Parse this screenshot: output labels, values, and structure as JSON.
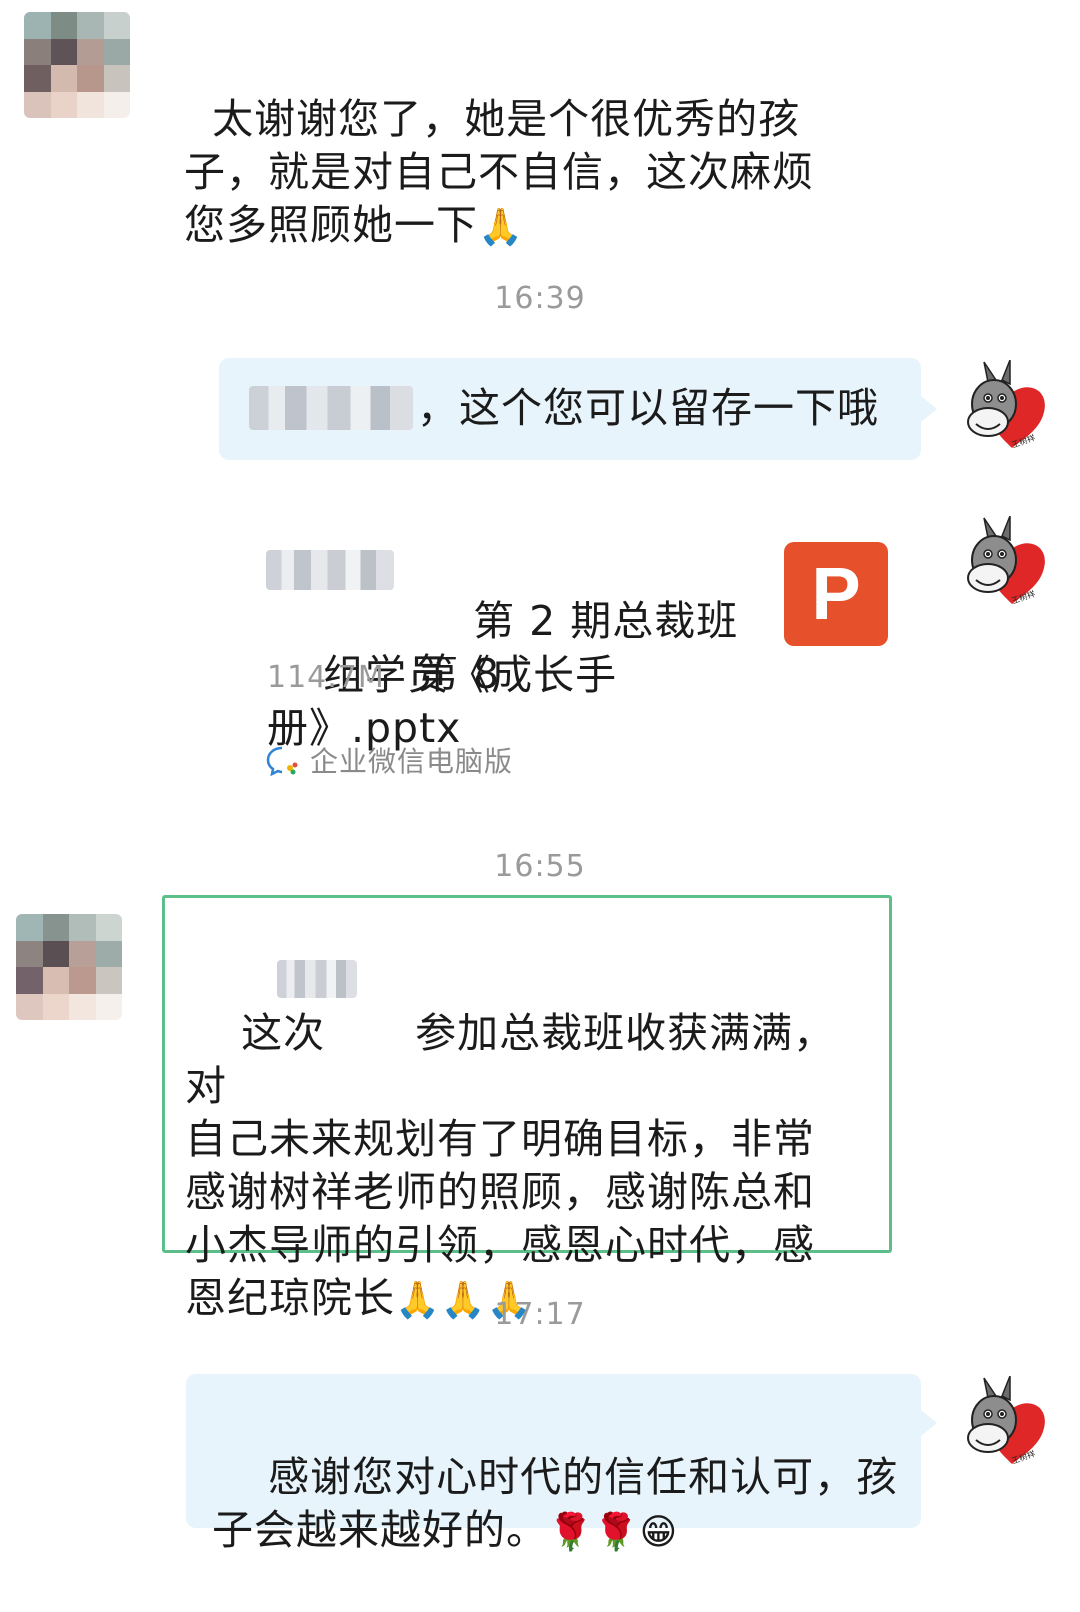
{
  "messages": [
    {
      "text_before": "太谢谢您了，她是个很优秀的孩\n子，就是对自己不自信，这次麻烦\n您多照顾她一下",
      "emoji": "🙏"
    },
    {
      "time": "16:39"
    },
    {
      "text": "，这个您可以留存一下哦"
    },
    {
      "file_title_line1": "第 2 期总裁班第 8",
      "file_title_line2": "组学员《成长手册》.pptx",
      "file_size": "114.7M",
      "file_icon_letter": "P",
      "source": "企业微信电脑版"
    },
    {
      "time": "16:55"
    },
    {
      "text_a": "这次",
      "text_b": "参加总裁班收获满满，对\n自己未来规划有了明确目标，非常\n感谢树祥老师的照顾，感谢陈总和\n小杰导师的引领，感恩心时代，感\n恩纪琼院长",
      "emoji": "🙏🙏🙏"
    },
    {
      "time": "17:17"
    },
    {
      "text": "感谢您对心时代的信任和认可，孩\n子会越来越好的。",
      "emoji": "🌹🌹😁"
    }
  ],
  "colors": {
    "bubble": "#e7f4fb",
    "highlight_border": "#5cbf8a",
    "pptx": "#e6502a",
    "time": "#9a9a9a"
  },
  "icons": {
    "avatar_right": "donkey-avatar-icon",
    "source_icon": "wecom-chat-icon"
  }
}
